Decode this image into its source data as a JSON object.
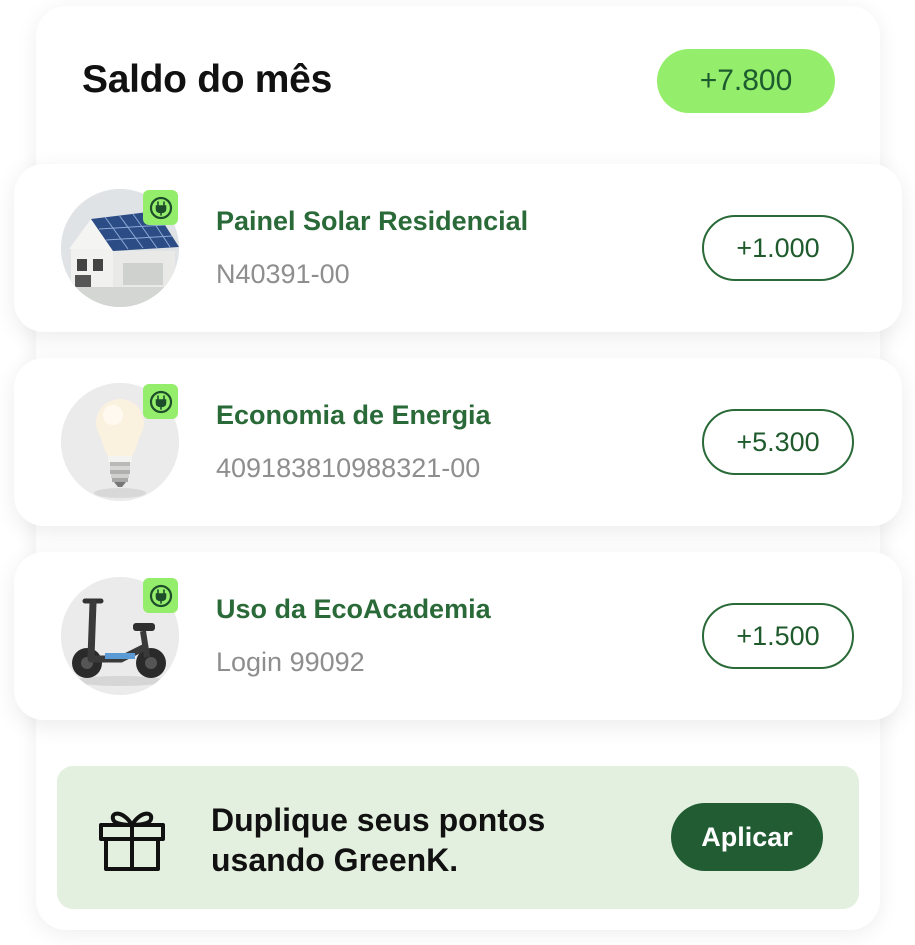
{
  "header": {
    "title": "Saldo do mês",
    "total": "+7.800"
  },
  "items": [
    {
      "title": "Painel Solar Residencial",
      "subtitle": "N40391-00",
      "points": "+1.000",
      "image": "solar-house",
      "badge_icon": "eco-plug-icon"
    },
    {
      "title": "Economia de Energia",
      "subtitle": "409183810988321-00",
      "points": "+5.300",
      "image": "light-bulb",
      "badge_icon": "eco-plug-icon"
    },
    {
      "title": "Uso da EcoAcademia",
      "subtitle": "Login 99092",
      "points": "+1.500",
      "image": "electric-scooter",
      "badge_icon": "eco-plug-icon"
    }
  ],
  "promo": {
    "line1": "Duplique seus pontos",
    "line2": "usando GreenK.",
    "button": "Aplicar",
    "icon": "gift-icon"
  },
  "colors": {
    "accent_green": "#95ee6b",
    "dark_green": "#215c33",
    "title_green": "#2a6a38",
    "promo_bg": "#e3f0df"
  }
}
